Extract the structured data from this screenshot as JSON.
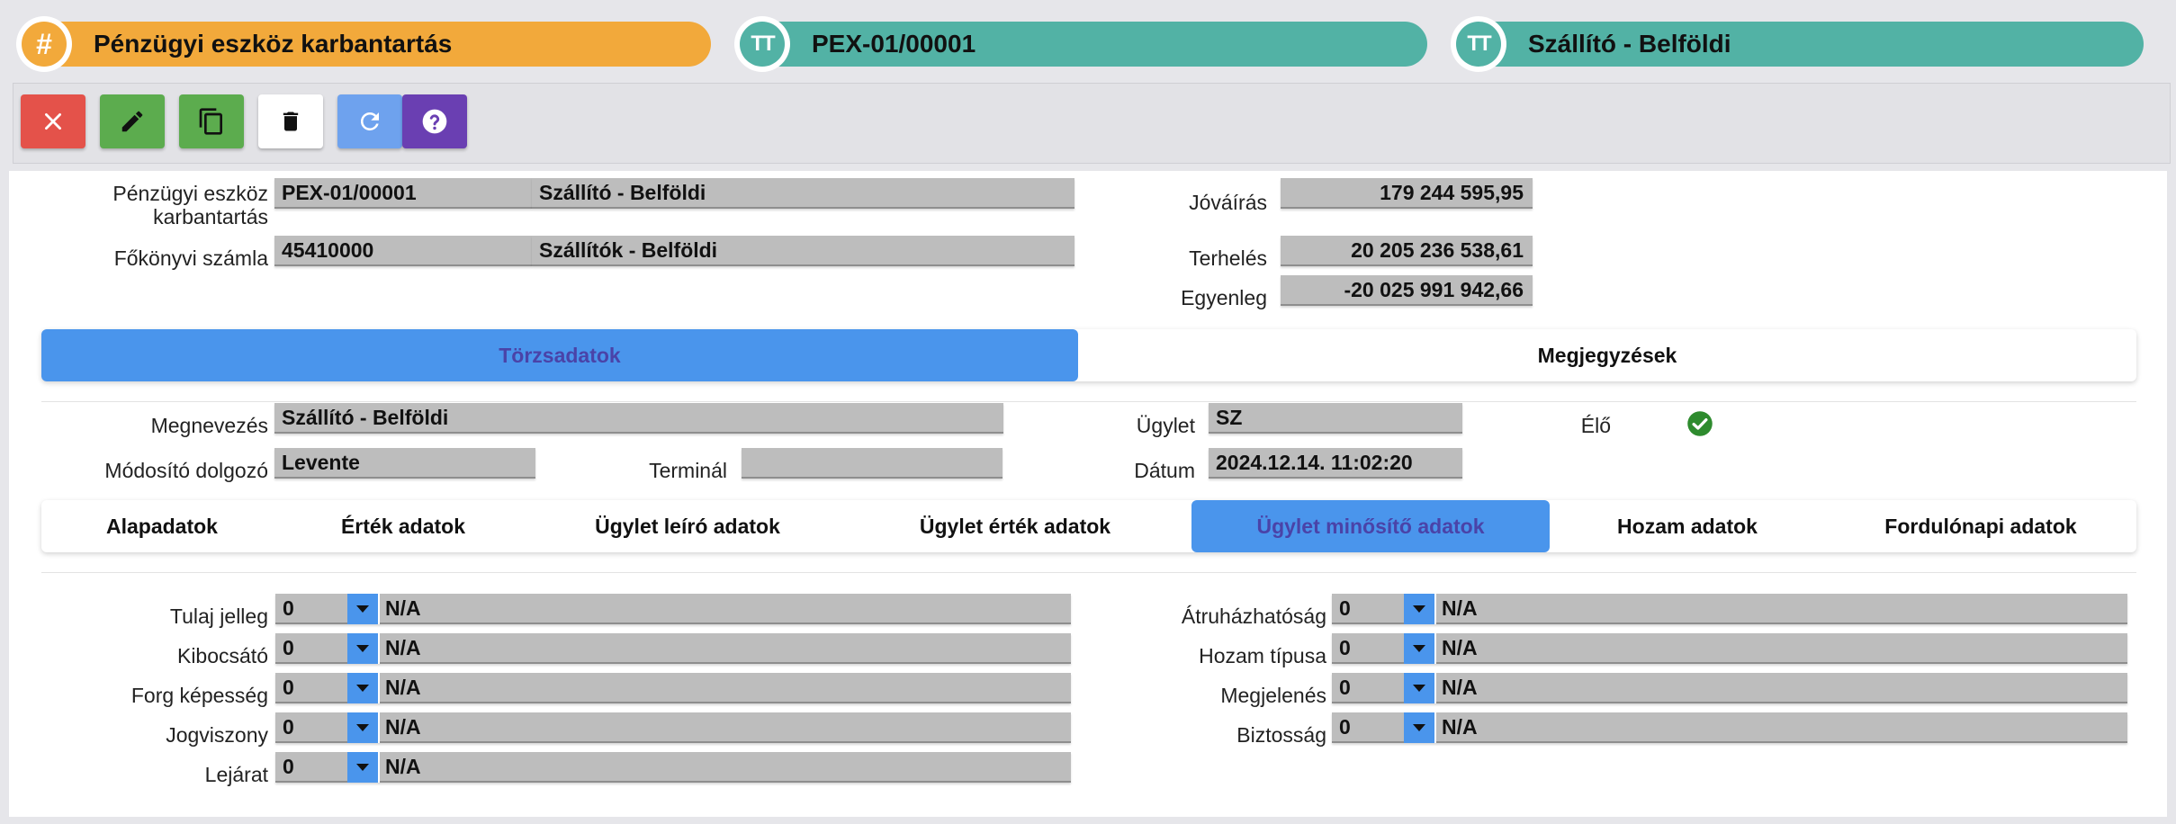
{
  "header": {
    "pill1": {
      "icon": "hash-icon",
      "icon_glyph": "#",
      "text": "Pénzügyi eszköz karbantartás",
      "color": "#f2a93b"
    },
    "pill2": {
      "icon": "text-icon",
      "icon_glyph": "TT",
      "text": "PEX-01/00001",
      "color": "#52b2a5"
    },
    "pill3": {
      "icon": "text-icon",
      "icon_glyph": "TT",
      "text": "Szállító - Belföldi",
      "color": "#52b2a5"
    }
  },
  "toolbar": {
    "buttons": [
      {
        "name": "close-button",
        "icon": "close-icon",
        "color": "#e4524a"
      },
      {
        "name": "edit-button",
        "icon": "pencil-icon",
        "color": "#5cac4e"
      },
      {
        "name": "copy-button",
        "icon": "copy-icon",
        "color": "#5cac4e"
      },
      {
        "name": "delete-button",
        "icon": "trash-icon",
        "color": "#ffffff"
      },
      {
        "name": "refresh-button",
        "icon": "refresh-icon",
        "color": "#6ea2ee"
      },
      {
        "name": "help-button",
        "icon": "help-icon",
        "color": "#6a3fb2"
      }
    ]
  },
  "summary": {
    "asset_label": "Pénzügyi eszköz karbantartás",
    "asset_code": "PEX-01/00001",
    "asset_name": "Szállító - Belföldi",
    "ledger_label": "Főkönyvi számla",
    "ledger_code": "45410000",
    "ledger_name": "Szállítók - Belföldi",
    "credit_label": "Jóváírás",
    "credit_value": "179 244 595,95",
    "debit_label": "Terhelés",
    "debit_value": "20 205 236 538,61",
    "balance_label": "Egyenleg",
    "balance_value": "-20 025 991 942,66"
  },
  "main_tabs": [
    {
      "label": "Törzsadatok",
      "active": true
    },
    {
      "label": "Megjegyzések",
      "active": false
    }
  ],
  "details": {
    "name_label": "Megnevezés",
    "name_value": "Szállító - Belföldi",
    "modifier_label": "Módosító dolgozó",
    "modifier_value": "Levente",
    "terminal_label": "Terminál",
    "terminal_value": "",
    "deal_label": "Ügylet",
    "deal_value": "SZ",
    "date_label": "Dátum",
    "date_value": "2024.12.14. 11:02:20",
    "live_label": "Élő",
    "live_icon": "check-circle-icon",
    "live_color": "#2e8b2e"
  },
  "sub_tabs": [
    {
      "label": "Alapadatok",
      "active": false
    },
    {
      "label": "Érték adatok",
      "active": false
    },
    {
      "label": "Ügylet leíró adatok",
      "active": false
    },
    {
      "label": "Ügylet érték adatok",
      "active": false
    },
    {
      "label": "Ügylet minősítő adatok",
      "active": true
    },
    {
      "label": "Hozam adatok",
      "active": false
    },
    {
      "label": "Fordulónapi adatok",
      "active": false
    }
  ],
  "left_fields": [
    {
      "label": "Tulaj jelleg",
      "code": "0",
      "desc": "N/A"
    },
    {
      "label": "Kibocsátó",
      "code": "0",
      "desc": "N/A"
    },
    {
      "label": "Forg képesség",
      "code": "0",
      "desc": "N/A"
    },
    {
      "label": "Jogviszony",
      "code": "0",
      "desc": "N/A"
    },
    {
      "label": "Lejárat",
      "code": "0",
      "desc": "N/A"
    }
  ],
  "right_fields": [
    {
      "label": "Átruházhatóság",
      "code": "0",
      "desc": "N/A"
    },
    {
      "label": "Hozam típusa",
      "code": "0",
      "desc": "N/A"
    },
    {
      "label": "Megjelenés",
      "code": "0",
      "desc": "N/A"
    },
    {
      "label": "Biztosság",
      "code": "0",
      "desc": "N/A"
    }
  ]
}
